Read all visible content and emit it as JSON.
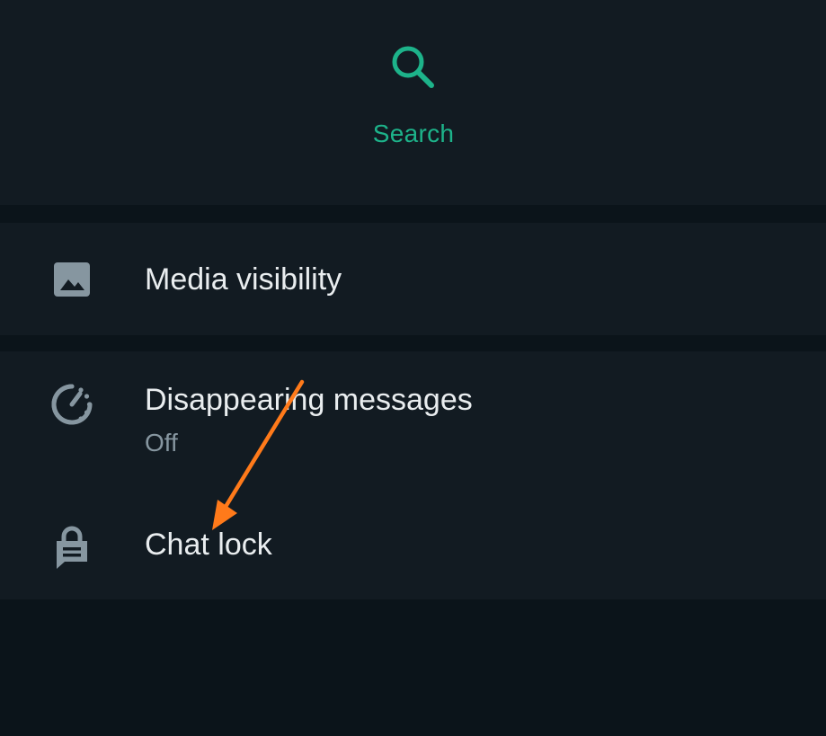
{
  "search": {
    "label": "Search",
    "icon": "search-icon",
    "accent_color": "#1db38a"
  },
  "settings": {
    "media_visibility": {
      "label": "Media visibility",
      "icon": "image-icon"
    },
    "disappearing_messages": {
      "label": "Disappearing messages",
      "value": "Off",
      "icon": "timer-icon"
    },
    "chat_lock": {
      "label": "Chat lock",
      "icon": "lock-chat-icon"
    }
  },
  "annotation": {
    "icon": "arrow-annotation-icon",
    "color": "#ff7a1a"
  }
}
